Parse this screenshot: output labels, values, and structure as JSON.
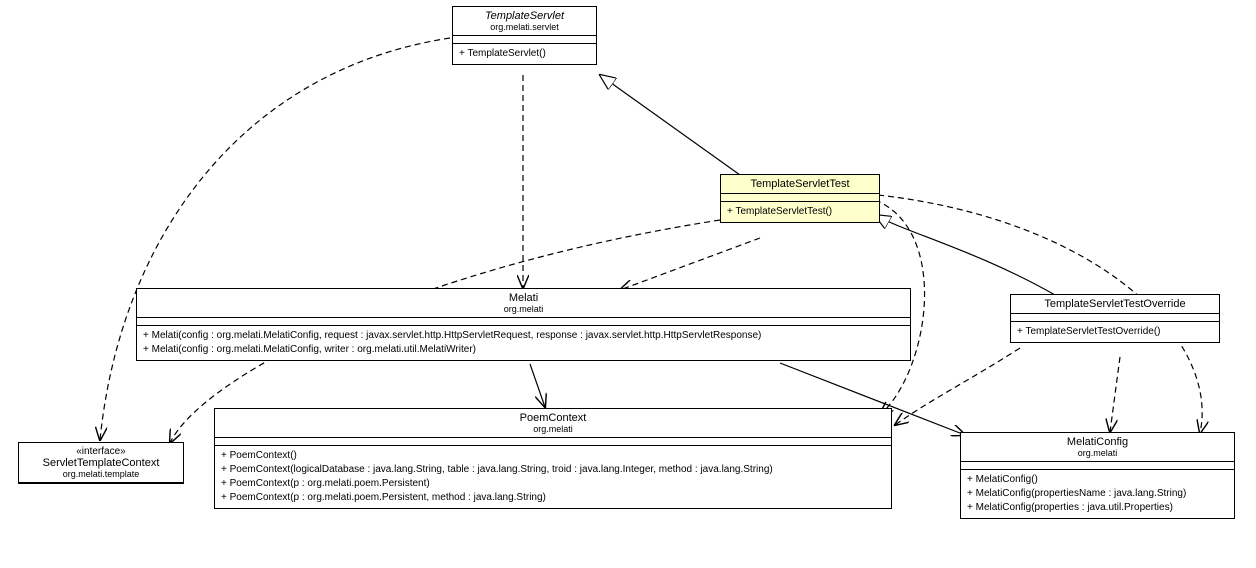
{
  "classes": {
    "templateServlet": {
      "name": "TemplateServlet",
      "package": "org.melati.servlet",
      "ops": [
        "+ TemplateServlet()"
      ]
    },
    "templateServletTest": {
      "name": "TemplateServletTest",
      "ops": [
        "+ TemplateServletTest()"
      ]
    },
    "templateServletTestOverride": {
      "name": "TemplateServletTestOverride",
      "ops": [
        "+ TemplateServletTestOverride()"
      ]
    },
    "melati": {
      "name": "Melati",
      "package": "org.melati",
      "ops": [
        "+ Melati(config : org.melati.MelatiConfig, request : javax.servlet.http.HttpServletRequest, response : javax.servlet.http.HttpServletResponse)",
        "+ Melati(config : org.melati.MelatiConfig, writer : org.melati.util.MelatiWriter)"
      ]
    },
    "servletTemplateContext": {
      "stereotype": "«interface»",
      "name": "ServletTemplateContext",
      "package": "org.melati.template"
    },
    "poemContext": {
      "name": "PoemContext",
      "package": "org.melati",
      "ops": [
        "+ PoemContext()",
        "+ PoemContext(logicalDatabase : java.lang.String, table : java.lang.String, troid : java.lang.Integer, method : java.lang.String)",
        "+ PoemContext(p : org.melati.poem.Persistent)",
        "+ PoemContext(p : org.melati.poem.Persistent, method : java.lang.String)"
      ]
    },
    "melatiConfig": {
      "name": "MelatiConfig",
      "package": "org.melati",
      "ops": [
        "+ MelatiConfig()",
        "+ MelatiConfig(propertiesName : java.lang.String)",
        "+ MelatiConfig(properties : java.util.Properties)"
      ]
    }
  }
}
